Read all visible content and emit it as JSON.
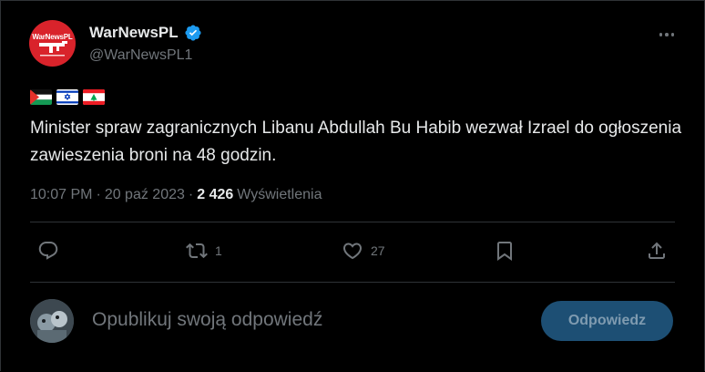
{
  "account": {
    "display_name": "WarNewsPL",
    "handle": "@WarNewsPL1",
    "logo_text": "WarNewsPL",
    "verified": true,
    "verified_color": "#1d9bf0",
    "avatar_color": "#d9232b"
  },
  "tweet": {
    "flags": [
      "Palestine",
      "Israel",
      "Lebanon"
    ],
    "text": "Minister spraw zagranicznych Libanu Abdullah Bu Habib wezwał Izrael do ogłoszenia zawieszenia broni na 48 godzin.",
    "time": "10:07 PM",
    "separator": "·",
    "date": "20 paź 2023",
    "views_count": "2 426",
    "views_label": "Wyświetlenia"
  },
  "actions": {
    "reply_count": "",
    "retweet_count": "1",
    "like_count": "27"
  },
  "reply": {
    "placeholder": "Opublikuj swoją odpowiedź",
    "button_label": "Odpowiedz"
  },
  "colors": {
    "background": "#000000",
    "text": "#e7e9ea",
    "muted": "#71767b",
    "button_bg": "#1d4f74"
  }
}
